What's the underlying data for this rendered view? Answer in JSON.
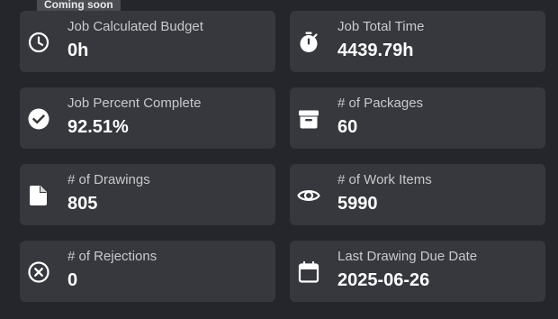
{
  "tooltip": {
    "text": "Coming soon"
  },
  "colors": {
    "background": "#24262b",
    "card": "#36383d",
    "label": "#c8c9cc",
    "value": "#ffffff"
  },
  "cards": [
    {
      "label": "Job Calculated Budget",
      "value": "0h",
      "icon": "clock-icon"
    },
    {
      "label": "Job Total Time",
      "value": "4439.79h",
      "icon": "stopwatch-icon"
    },
    {
      "label": "Job Percent Complete",
      "value": "92.51%",
      "icon": "check-circle-icon"
    },
    {
      "label": "# of Packages",
      "value": "60",
      "icon": "archive-box-icon"
    },
    {
      "label": "# of Drawings",
      "value": "805",
      "icon": "document-icon"
    },
    {
      "label": "# of Work Items",
      "value": "5990",
      "icon": "eye-icon"
    },
    {
      "label": "# of Rejections",
      "value": "0",
      "icon": "cancel-circle-icon"
    },
    {
      "label": "Last Drawing Due Date",
      "value": "2025-06-26",
      "icon": "calendar-icon"
    }
  ]
}
